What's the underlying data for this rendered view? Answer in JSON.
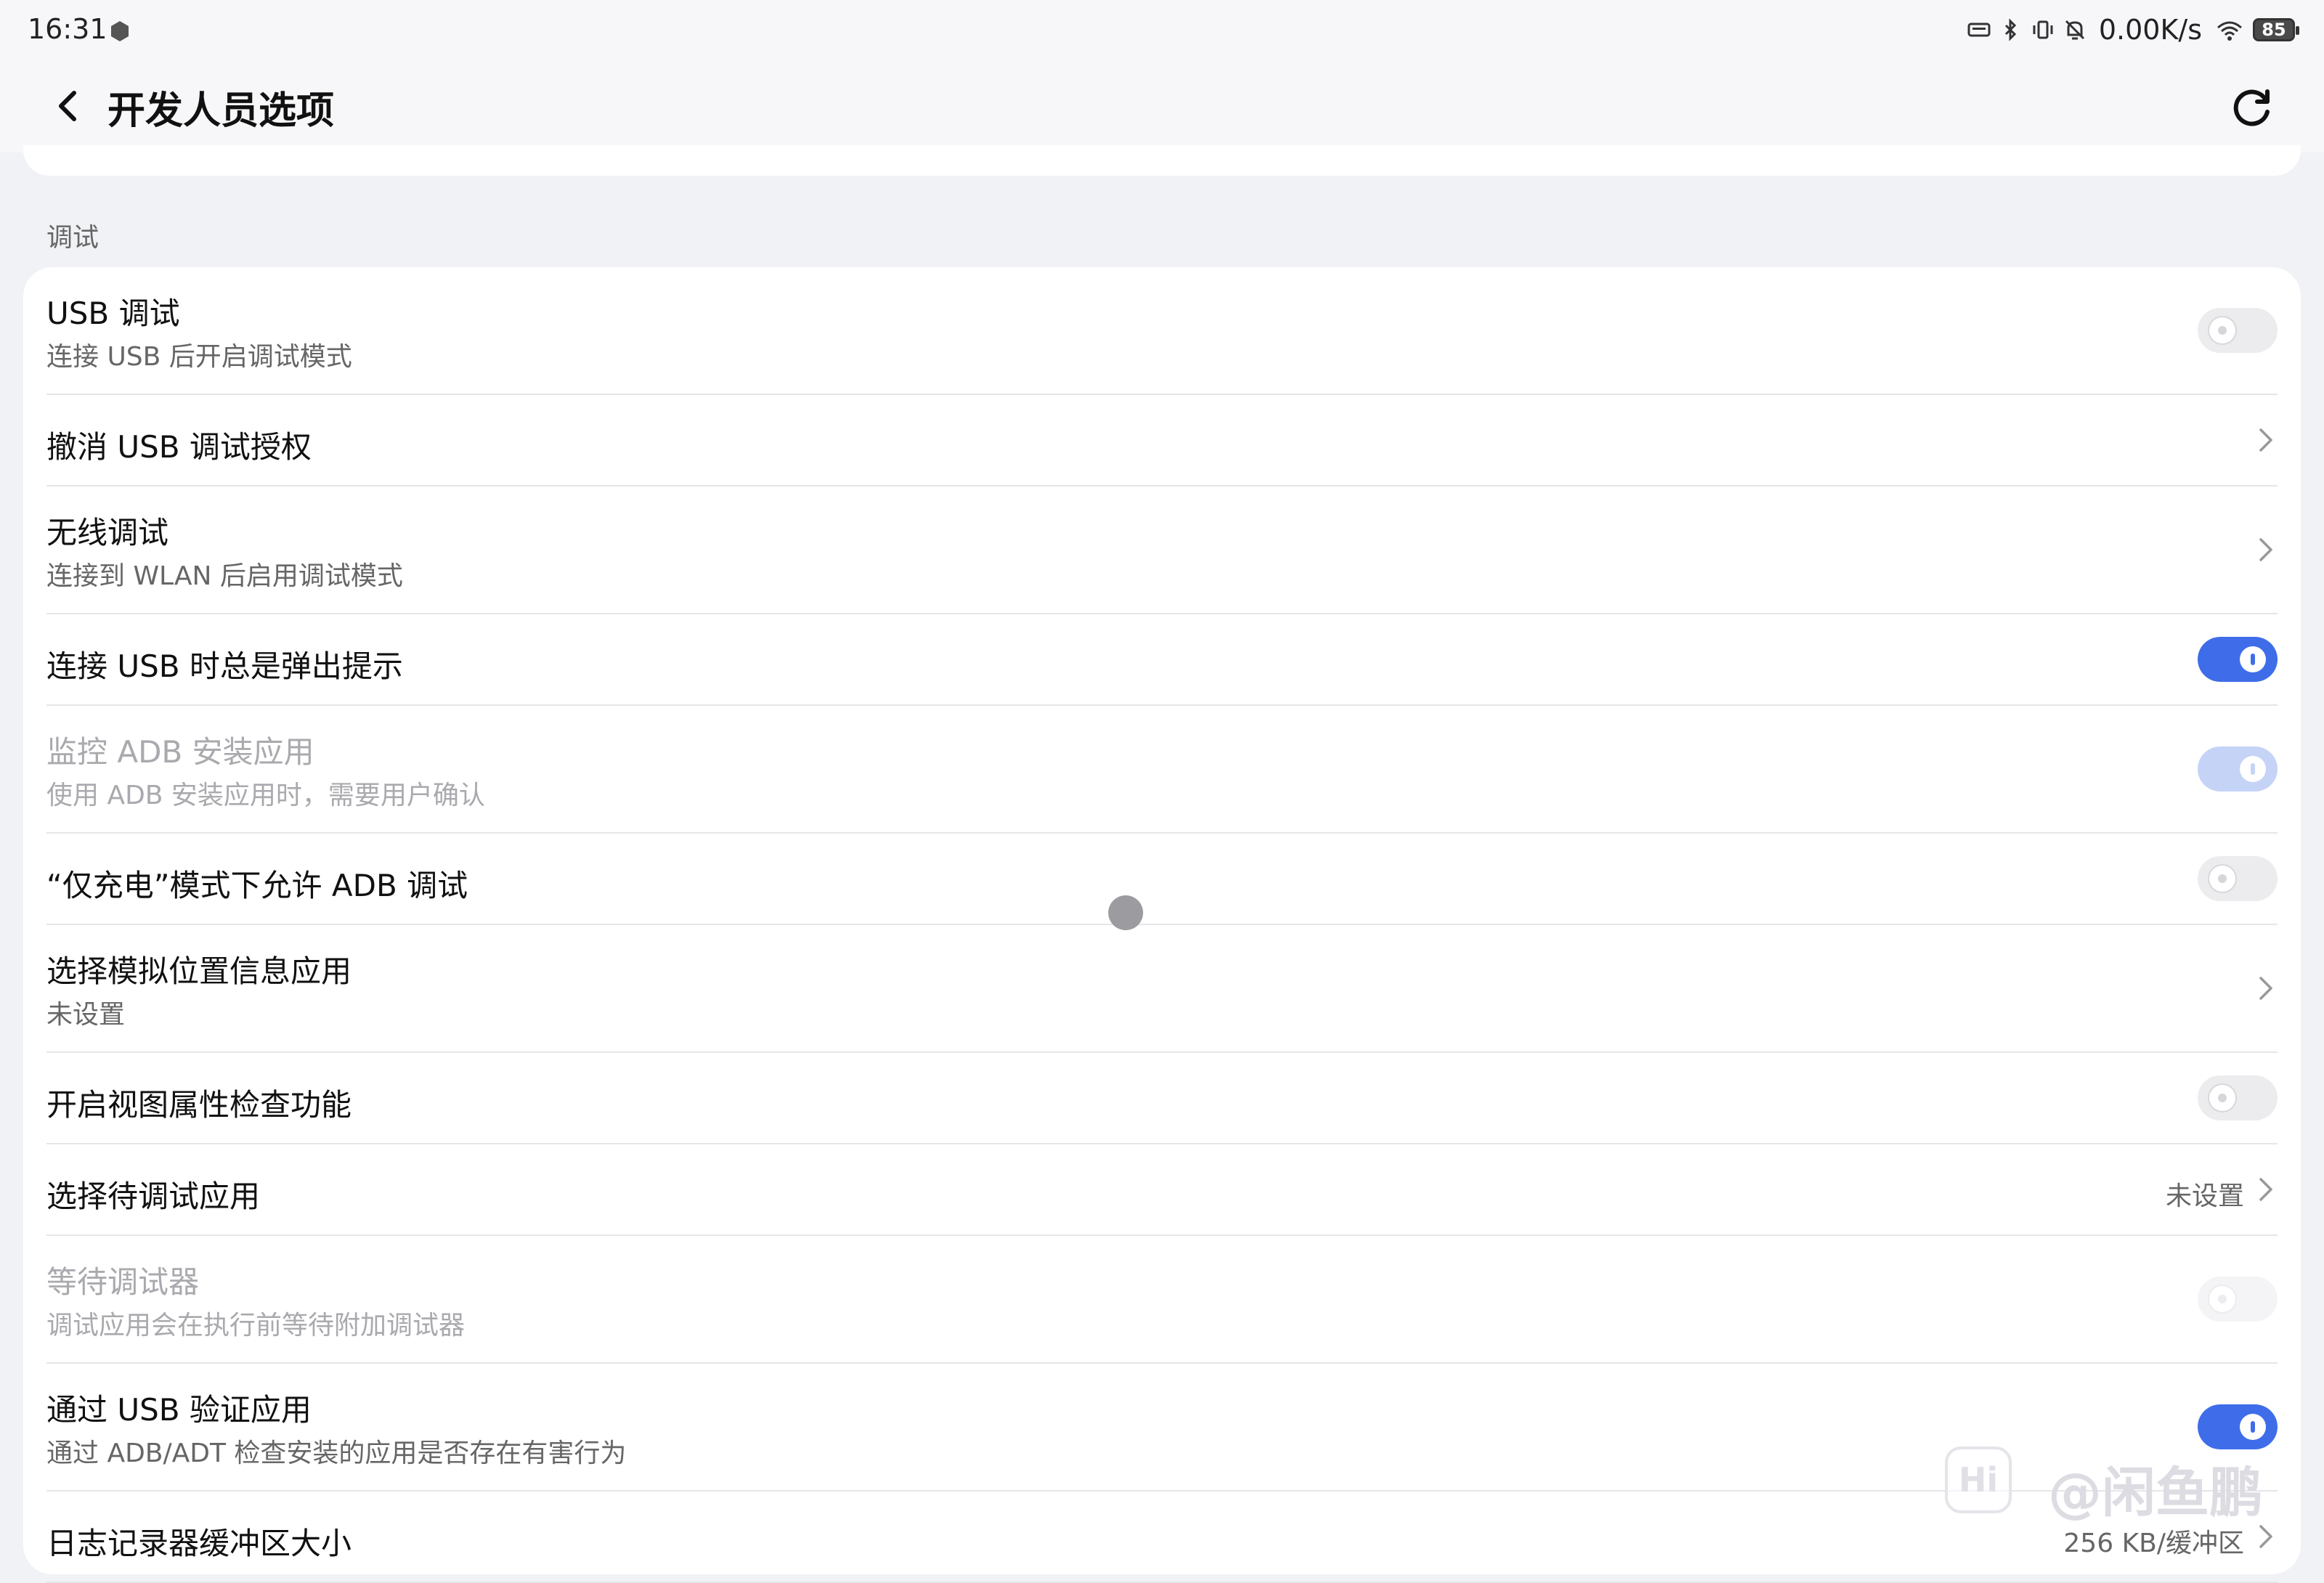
{
  "status_bar": {
    "time": "16:31",
    "net_speed": "0.00K/s",
    "battery": "85",
    "icons": [
      "app-notification-icon",
      "keyboard-icon",
      "bluetooth-icon",
      "vibrate-icon",
      "mute-icon",
      "wifi-icon",
      "battery-icon"
    ]
  },
  "header": {
    "title": "开发人员选项",
    "back_icon": "back-arrow-icon",
    "refresh_icon": "refresh-icon"
  },
  "section": {
    "title": "调试"
  },
  "rows": [
    {
      "title": "USB 调试",
      "subtitle": "连接 USB 后开启调试模式",
      "control": "toggle",
      "state": "off",
      "enabled": true
    },
    {
      "title": "撤消 USB 调试授权",
      "control": "chevron",
      "enabled": true
    },
    {
      "title": "无线调试",
      "subtitle": "连接到 WLAN 后启用调试模式",
      "control": "chevron",
      "enabled": true
    },
    {
      "title": "连接 USB 时总是弹出提示",
      "control": "toggle",
      "state": "on",
      "enabled": true
    },
    {
      "title": "监控 ADB 安装应用",
      "subtitle": "使用 ADB 安装应用时，需要用户确认",
      "control": "toggle",
      "state": "on",
      "enabled": false
    },
    {
      "title": "“仅充电”模式下允许 ADB 调试",
      "control": "toggle",
      "state": "off",
      "enabled": true
    },
    {
      "title": "选择模拟位置信息应用",
      "subtitle": "未设置",
      "control": "chevron",
      "enabled": true
    },
    {
      "title": "开启视图属性检查功能",
      "control": "toggle",
      "state": "off",
      "enabled": true
    },
    {
      "title": "选择待调试应用",
      "value": "未设置",
      "control": "chevron",
      "enabled": true
    },
    {
      "title": "等待调试器",
      "subtitle": "调试应用会在执行前等待附加调试器",
      "control": "toggle",
      "state": "off",
      "enabled": false
    },
    {
      "title": "通过 USB 验证应用",
      "subtitle": "通过 ADB/ADT 检查安装的应用是否存在有害行为",
      "control": "toggle",
      "state": "on",
      "enabled": true
    },
    {
      "title": "日志记录器缓冲区大小",
      "value": "256 KB/缓冲区",
      "control": "chevron",
      "enabled": true
    }
  ],
  "watermark": {
    "logo": "Hi",
    "text": "@闲鱼鹏"
  },
  "colors": {
    "accent": "#3f6de9",
    "background": "#f1f2f6",
    "card": "#ffffff"
  }
}
